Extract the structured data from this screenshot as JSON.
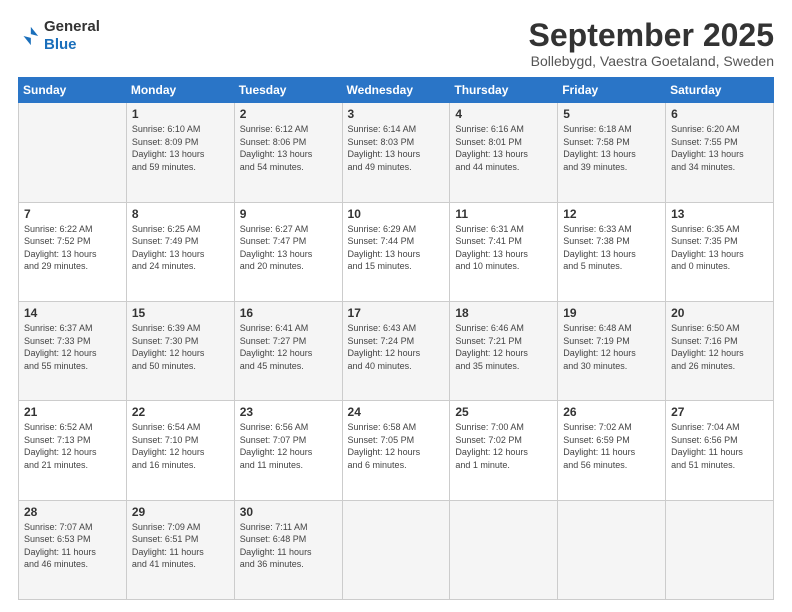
{
  "header": {
    "logo_general": "General",
    "logo_blue": "Blue",
    "month": "September 2025",
    "location": "Bollebygd, Vaestra Goetaland, Sweden"
  },
  "weekdays": [
    "Sunday",
    "Monday",
    "Tuesday",
    "Wednesday",
    "Thursday",
    "Friday",
    "Saturday"
  ],
  "rows": [
    [
      {
        "day": "",
        "info": ""
      },
      {
        "day": "1",
        "info": "Sunrise: 6:10 AM\nSunset: 8:09 PM\nDaylight: 13 hours\nand 59 minutes."
      },
      {
        "day": "2",
        "info": "Sunrise: 6:12 AM\nSunset: 8:06 PM\nDaylight: 13 hours\nand 54 minutes."
      },
      {
        "day": "3",
        "info": "Sunrise: 6:14 AM\nSunset: 8:03 PM\nDaylight: 13 hours\nand 49 minutes."
      },
      {
        "day": "4",
        "info": "Sunrise: 6:16 AM\nSunset: 8:01 PM\nDaylight: 13 hours\nand 44 minutes."
      },
      {
        "day": "5",
        "info": "Sunrise: 6:18 AM\nSunset: 7:58 PM\nDaylight: 13 hours\nand 39 minutes."
      },
      {
        "day": "6",
        "info": "Sunrise: 6:20 AM\nSunset: 7:55 PM\nDaylight: 13 hours\nand 34 minutes."
      }
    ],
    [
      {
        "day": "7",
        "info": "Sunrise: 6:22 AM\nSunset: 7:52 PM\nDaylight: 13 hours\nand 29 minutes."
      },
      {
        "day": "8",
        "info": "Sunrise: 6:25 AM\nSunset: 7:49 PM\nDaylight: 13 hours\nand 24 minutes."
      },
      {
        "day": "9",
        "info": "Sunrise: 6:27 AM\nSunset: 7:47 PM\nDaylight: 13 hours\nand 20 minutes."
      },
      {
        "day": "10",
        "info": "Sunrise: 6:29 AM\nSunset: 7:44 PM\nDaylight: 13 hours\nand 15 minutes."
      },
      {
        "day": "11",
        "info": "Sunrise: 6:31 AM\nSunset: 7:41 PM\nDaylight: 13 hours\nand 10 minutes."
      },
      {
        "day": "12",
        "info": "Sunrise: 6:33 AM\nSunset: 7:38 PM\nDaylight: 13 hours\nand 5 minutes."
      },
      {
        "day": "13",
        "info": "Sunrise: 6:35 AM\nSunset: 7:35 PM\nDaylight: 13 hours\nand 0 minutes."
      }
    ],
    [
      {
        "day": "14",
        "info": "Sunrise: 6:37 AM\nSunset: 7:33 PM\nDaylight: 12 hours\nand 55 minutes."
      },
      {
        "day": "15",
        "info": "Sunrise: 6:39 AM\nSunset: 7:30 PM\nDaylight: 12 hours\nand 50 minutes."
      },
      {
        "day": "16",
        "info": "Sunrise: 6:41 AM\nSunset: 7:27 PM\nDaylight: 12 hours\nand 45 minutes."
      },
      {
        "day": "17",
        "info": "Sunrise: 6:43 AM\nSunset: 7:24 PM\nDaylight: 12 hours\nand 40 minutes."
      },
      {
        "day": "18",
        "info": "Sunrise: 6:46 AM\nSunset: 7:21 PM\nDaylight: 12 hours\nand 35 minutes."
      },
      {
        "day": "19",
        "info": "Sunrise: 6:48 AM\nSunset: 7:19 PM\nDaylight: 12 hours\nand 30 minutes."
      },
      {
        "day": "20",
        "info": "Sunrise: 6:50 AM\nSunset: 7:16 PM\nDaylight: 12 hours\nand 26 minutes."
      }
    ],
    [
      {
        "day": "21",
        "info": "Sunrise: 6:52 AM\nSunset: 7:13 PM\nDaylight: 12 hours\nand 21 minutes."
      },
      {
        "day": "22",
        "info": "Sunrise: 6:54 AM\nSunset: 7:10 PM\nDaylight: 12 hours\nand 16 minutes."
      },
      {
        "day": "23",
        "info": "Sunrise: 6:56 AM\nSunset: 7:07 PM\nDaylight: 12 hours\nand 11 minutes."
      },
      {
        "day": "24",
        "info": "Sunrise: 6:58 AM\nSunset: 7:05 PM\nDaylight: 12 hours\nand 6 minutes."
      },
      {
        "day": "25",
        "info": "Sunrise: 7:00 AM\nSunset: 7:02 PM\nDaylight: 12 hours\nand 1 minute."
      },
      {
        "day": "26",
        "info": "Sunrise: 7:02 AM\nSunset: 6:59 PM\nDaylight: 11 hours\nand 56 minutes."
      },
      {
        "day": "27",
        "info": "Sunrise: 7:04 AM\nSunset: 6:56 PM\nDaylight: 11 hours\nand 51 minutes."
      }
    ],
    [
      {
        "day": "28",
        "info": "Sunrise: 7:07 AM\nSunset: 6:53 PM\nDaylight: 11 hours\nand 46 minutes."
      },
      {
        "day": "29",
        "info": "Sunrise: 7:09 AM\nSunset: 6:51 PM\nDaylight: 11 hours\nand 41 minutes."
      },
      {
        "day": "30",
        "info": "Sunrise: 7:11 AM\nSunset: 6:48 PM\nDaylight: 11 hours\nand 36 minutes."
      },
      {
        "day": "",
        "info": ""
      },
      {
        "day": "",
        "info": ""
      },
      {
        "day": "",
        "info": ""
      },
      {
        "day": "",
        "info": ""
      }
    ]
  ]
}
